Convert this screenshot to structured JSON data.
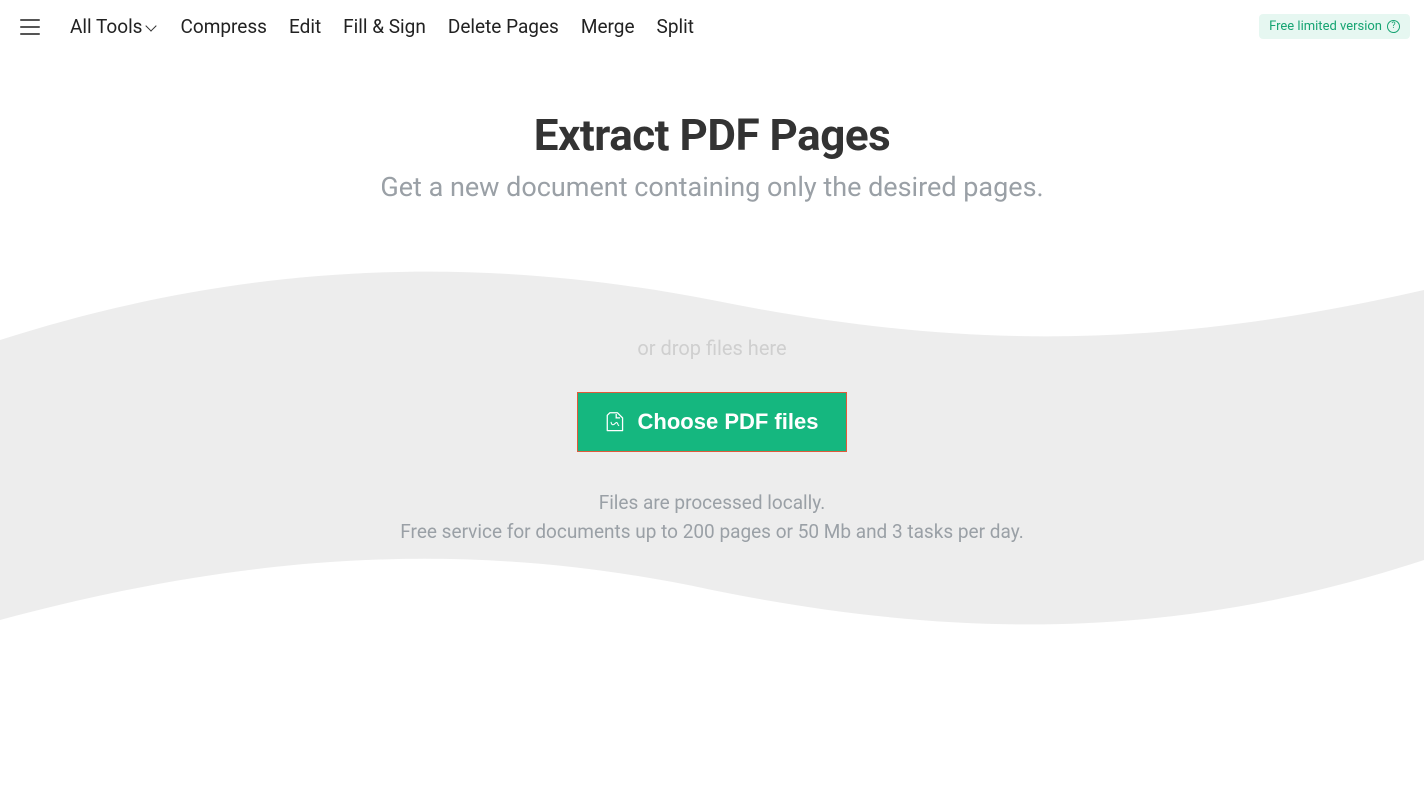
{
  "nav": {
    "all_tools": "All Tools",
    "items": [
      "Compress",
      "Edit",
      "Fill & Sign",
      "Delete Pages",
      "Merge",
      "Split"
    ]
  },
  "badge": {
    "label": "Free limited version"
  },
  "hero": {
    "title": "Extract PDF Pages",
    "subtitle": "Get a new document containing only the desired pages."
  },
  "drop": {
    "hint": "or drop files here",
    "button": "Choose PDF files",
    "info1": "Files are processed locally.",
    "info2": "Free service for documents up to 200 pages or 50 Mb and 3 tasks per day."
  },
  "colors": {
    "accent": "#15b77f",
    "badge_bg": "#e6f7f1",
    "badge_text": "#16a472",
    "muted": "#9aa0a6",
    "wave": "#ededed",
    "btn_border": "#e05a3a"
  }
}
